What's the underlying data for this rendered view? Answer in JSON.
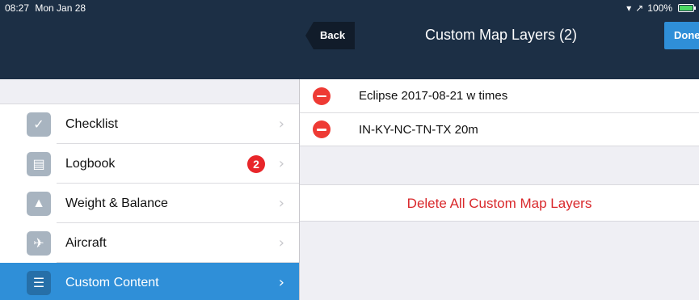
{
  "status_bar": {
    "time": "08:27",
    "date": "Mon Jan 28",
    "wifi": "▾",
    "location": "↗",
    "battery_text": "100%",
    "battery_level": 1.0
  },
  "nav": {
    "back_label": "Back",
    "title": "Custom Map Layers (2)",
    "done_label": "Done"
  },
  "sidebar": {
    "items": [
      {
        "label": "Checklist",
        "icon": "✓",
        "badge": "",
        "selected": false
      },
      {
        "label": "Logbook",
        "icon": "▤",
        "badge": "2",
        "selected": false
      },
      {
        "label": "Weight & Balance",
        "icon": "▲",
        "badge": "",
        "selected": false
      },
      {
        "label": "Aircraft",
        "icon": "✈",
        "badge": "",
        "selected": false
      },
      {
        "label": "Custom Content",
        "icon": "☰",
        "badge": "",
        "selected": true
      }
    ],
    "chevron": "›"
  },
  "detail": {
    "layers": [
      {
        "name": "Eclipse 2017-08-21 w times"
      },
      {
        "name": "IN-KY-NC-TN-TX 20m"
      }
    ],
    "delete_all_label": "Delete All Custom Map Layers"
  },
  "colors": {
    "nav_background": "#1c2f45",
    "accent_blue": "#2f8fd8",
    "destructive_red": "#d9282b",
    "badge_red": "#e8262a"
  }
}
